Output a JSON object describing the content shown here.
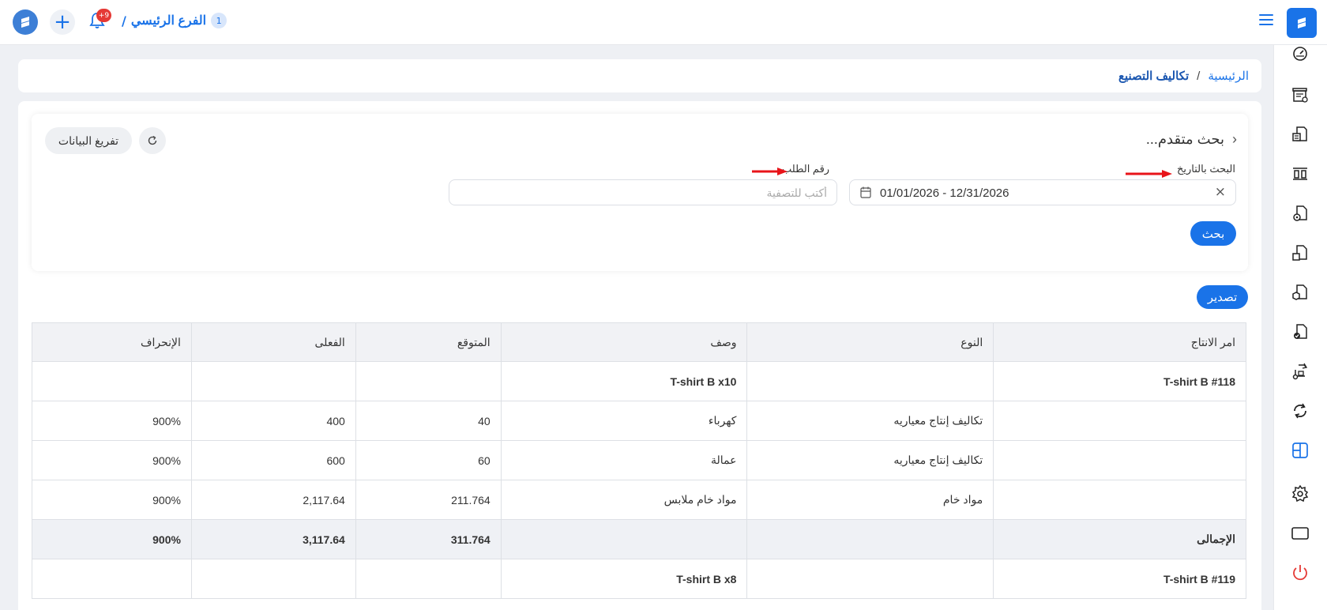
{
  "topbar": {
    "branch_number": "1",
    "branch_name": "الفرع الرئيسي",
    "branch_separator": "/",
    "notification_badge": "+9"
  },
  "breadcrumb": {
    "home": "الرئيسية",
    "separator": "/",
    "current": "تكاليف التصنيع"
  },
  "search": {
    "title": "بحث متقدم...",
    "date_label": "البحث بالتاريخ",
    "date_value": "01/01/2026 - 12/31/2026",
    "order_label": "رقم الطلب",
    "order_placeholder": "أكتب للتصفية",
    "search_button": "بحث",
    "clear_button": "تفريغ البيانات"
  },
  "export_button": "تصدير",
  "table": {
    "headers": [
      "امر الانتاج",
      "النوع",
      "وصف",
      "المتوقع",
      "الفعلى",
      "الإنحراف"
    ],
    "rows": [
      {
        "kind": "group",
        "cells": [
          "T-shirt B #118",
          "",
          "T-shirt B x10",
          "",
          "",
          ""
        ]
      },
      {
        "kind": "item",
        "cells": [
          "",
          "تكاليف إنتاج معياريه",
          "كهرباء",
          "40",
          "400",
          "900%"
        ]
      },
      {
        "kind": "item",
        "cells": [
          "",
          "تكاليف إنتاج معياريه",
          "عمالة",
          "60",
          "600",
          "900%"
        ]
      },
      {
        "kind": "item",
        "cells": [
          "",
          "مواد خام",
          "مواد خام ملابس",
          "211.764",
          "2,117.64",
          "900%"
        ]
      },
      {
        "kind": "total",
        "cells": [
          "الإجمالى",
          "",
          "",
          "311.764",
          "3,117.64",
          "900%"
        ]
      },
      {
        "kind": "group",
        "cells": [
          "T-shirt B #119",
          "",
          "T-shirt B x8",
          "",
          "",
          ""
        ]
      }
    ]
  },
  "colors": {
    "accent": "#1a73e8",
    "arrow": "#e8141a",
    "badge": "#e53935"
  },
  "sidebar_icons": [
    "gauge-icon",
    "store-icon",
    "cash-register-icon",
    "columns-icon",
    "document-eye-icon",
    "document-up-icon",
    "document-box-icon",
    "document-check-icon",
    "truck-arrow-icon",
    "sync-icon",
    "layout-icon",
    "gear-icon",
    "tablet-icon",
    "power-icon"
  ]
}
